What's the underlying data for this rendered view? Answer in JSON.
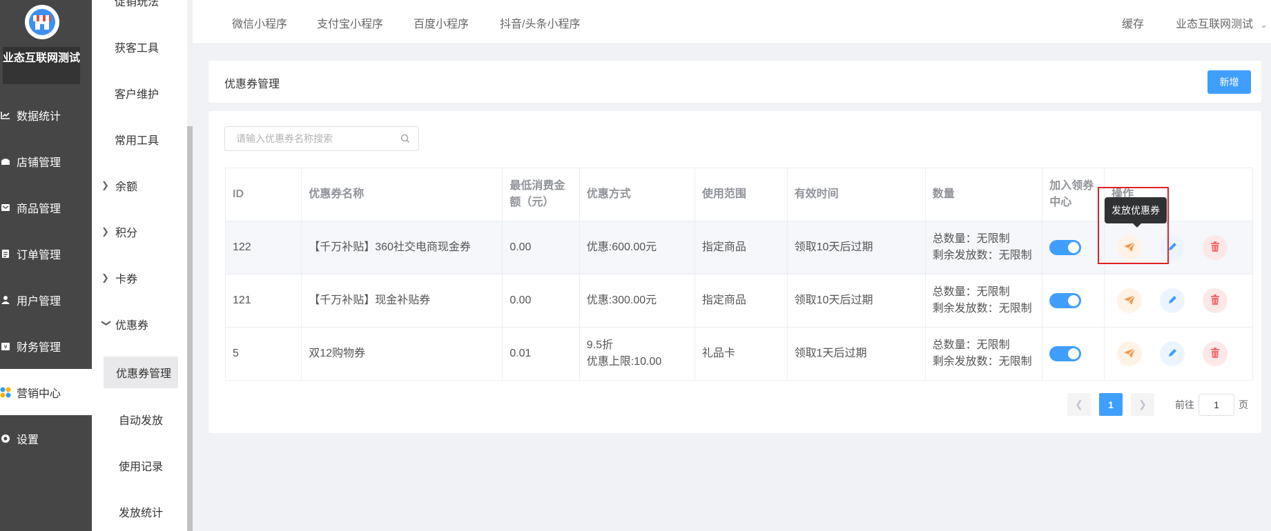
{
  "sidebar": {
    "brand": "业态互联网测试",
    "items": [
      {
        "label": "数据统计",
        "icon": "chart-line-icon"
      },
      {
        "label": "店铺管理",
        "icon": "store-icon"
      },
      {
        "label": "商品管理",
        "icon": "goods-icon"
      },
      {
        "label": "订单管理",
        "icon": "order-icon"
      },
      {
        "label": "用户管理",
        "icon": "user-icon"
      },
      {
        "label": "财务管理",
        "icon": "finance-icon"
      },
      {
        "label": "营销中心",
        "icon": "marketing-icon",
        "active": true
      },
      {
        "label": "设置",
        "icon": "settings-icon"
      }
    ]
  },
  "submenu": {
    "items": [
      "促销玩法",
      "获客工具",
      "客户维护",
      "常用工具"
    ],
    "groups": [
      "余额",
      "积分",
      "卡券",
      "优惠券"
    ],
    "coupon_children": [
      "优惠券管理",
      "自动发放",
      "使用记录",
      "发放统计"
    ]
  },
  "topbar": {
    "tabs": [
      "微信小程序",
      "支付宝小程序",
      "百度小程序",
      "抖音/头条小程序"
    ],
    "cache": "缓存",
    "account": "业态互联网测试"
  },
  "page": {
    "title": "优惠券管理",
    "add_label": "新增",
    "search_placeholder": "请输入优惠券名称搜索"
  },
  "table": {
    "columns": [
      "ID",
      "优惠券名称",
      "最低消费金额（元）",
      "优惠方式",
      "使用范围",
      "有效时间",
      "数量",
      "加入领券中心",
      "操作"
    ],
    "rows": [
      {
        "id": "122",
        "name": "【千万补贴】360社交电商现金券",
        "min": "0.00",
        "discount": "优惠:600.00元",
        "discount2": "",
        "scope": "指定商品",
        "valid": "领取10天后过期",
        "total": "总数量：无限制",
        "remain": "剩余发放数：无限制",
        "in_center": true
      },
      {
        "id": "121",
        "name": "【千万补贴】现金补贴券",
        "min": "0.00",
        "discount": "优惠:300.00元",
        "discount2": "",
        "scope": "指定商品",
        "valid": "领取10天后过期",
        "total": "总数量：无限制",
        "remain": "剩余发放数：无限制",
        "in_center": true
      },
      {
        "id": "5",
        "name": "双12购物券",
        "min": "0.01",
        "discount": "9.5折",
        "discount2": "优惠上限:10.00",
        "scope": "礼品卡",
        "valid": "领取1天后过期",
        "total": "总数量：无限制",
        "remain": "剩余发放数：无限制",
        "in_center": true
      }
    ]
  },
  "tooltip": "发放优惠券",
  "pagination": {
    "current": "1",
    "goto_prefix": "前往",
    "goto_value": "1",
    "goto_suffix": "页"
  },
  "colors": {
    "primary": "#409eff",
    "sidebar_bg": "#464646",
    "send": "#f7984a",
    "edit": "#409eff",
    "delete": "#f56c6c"
  }
}
